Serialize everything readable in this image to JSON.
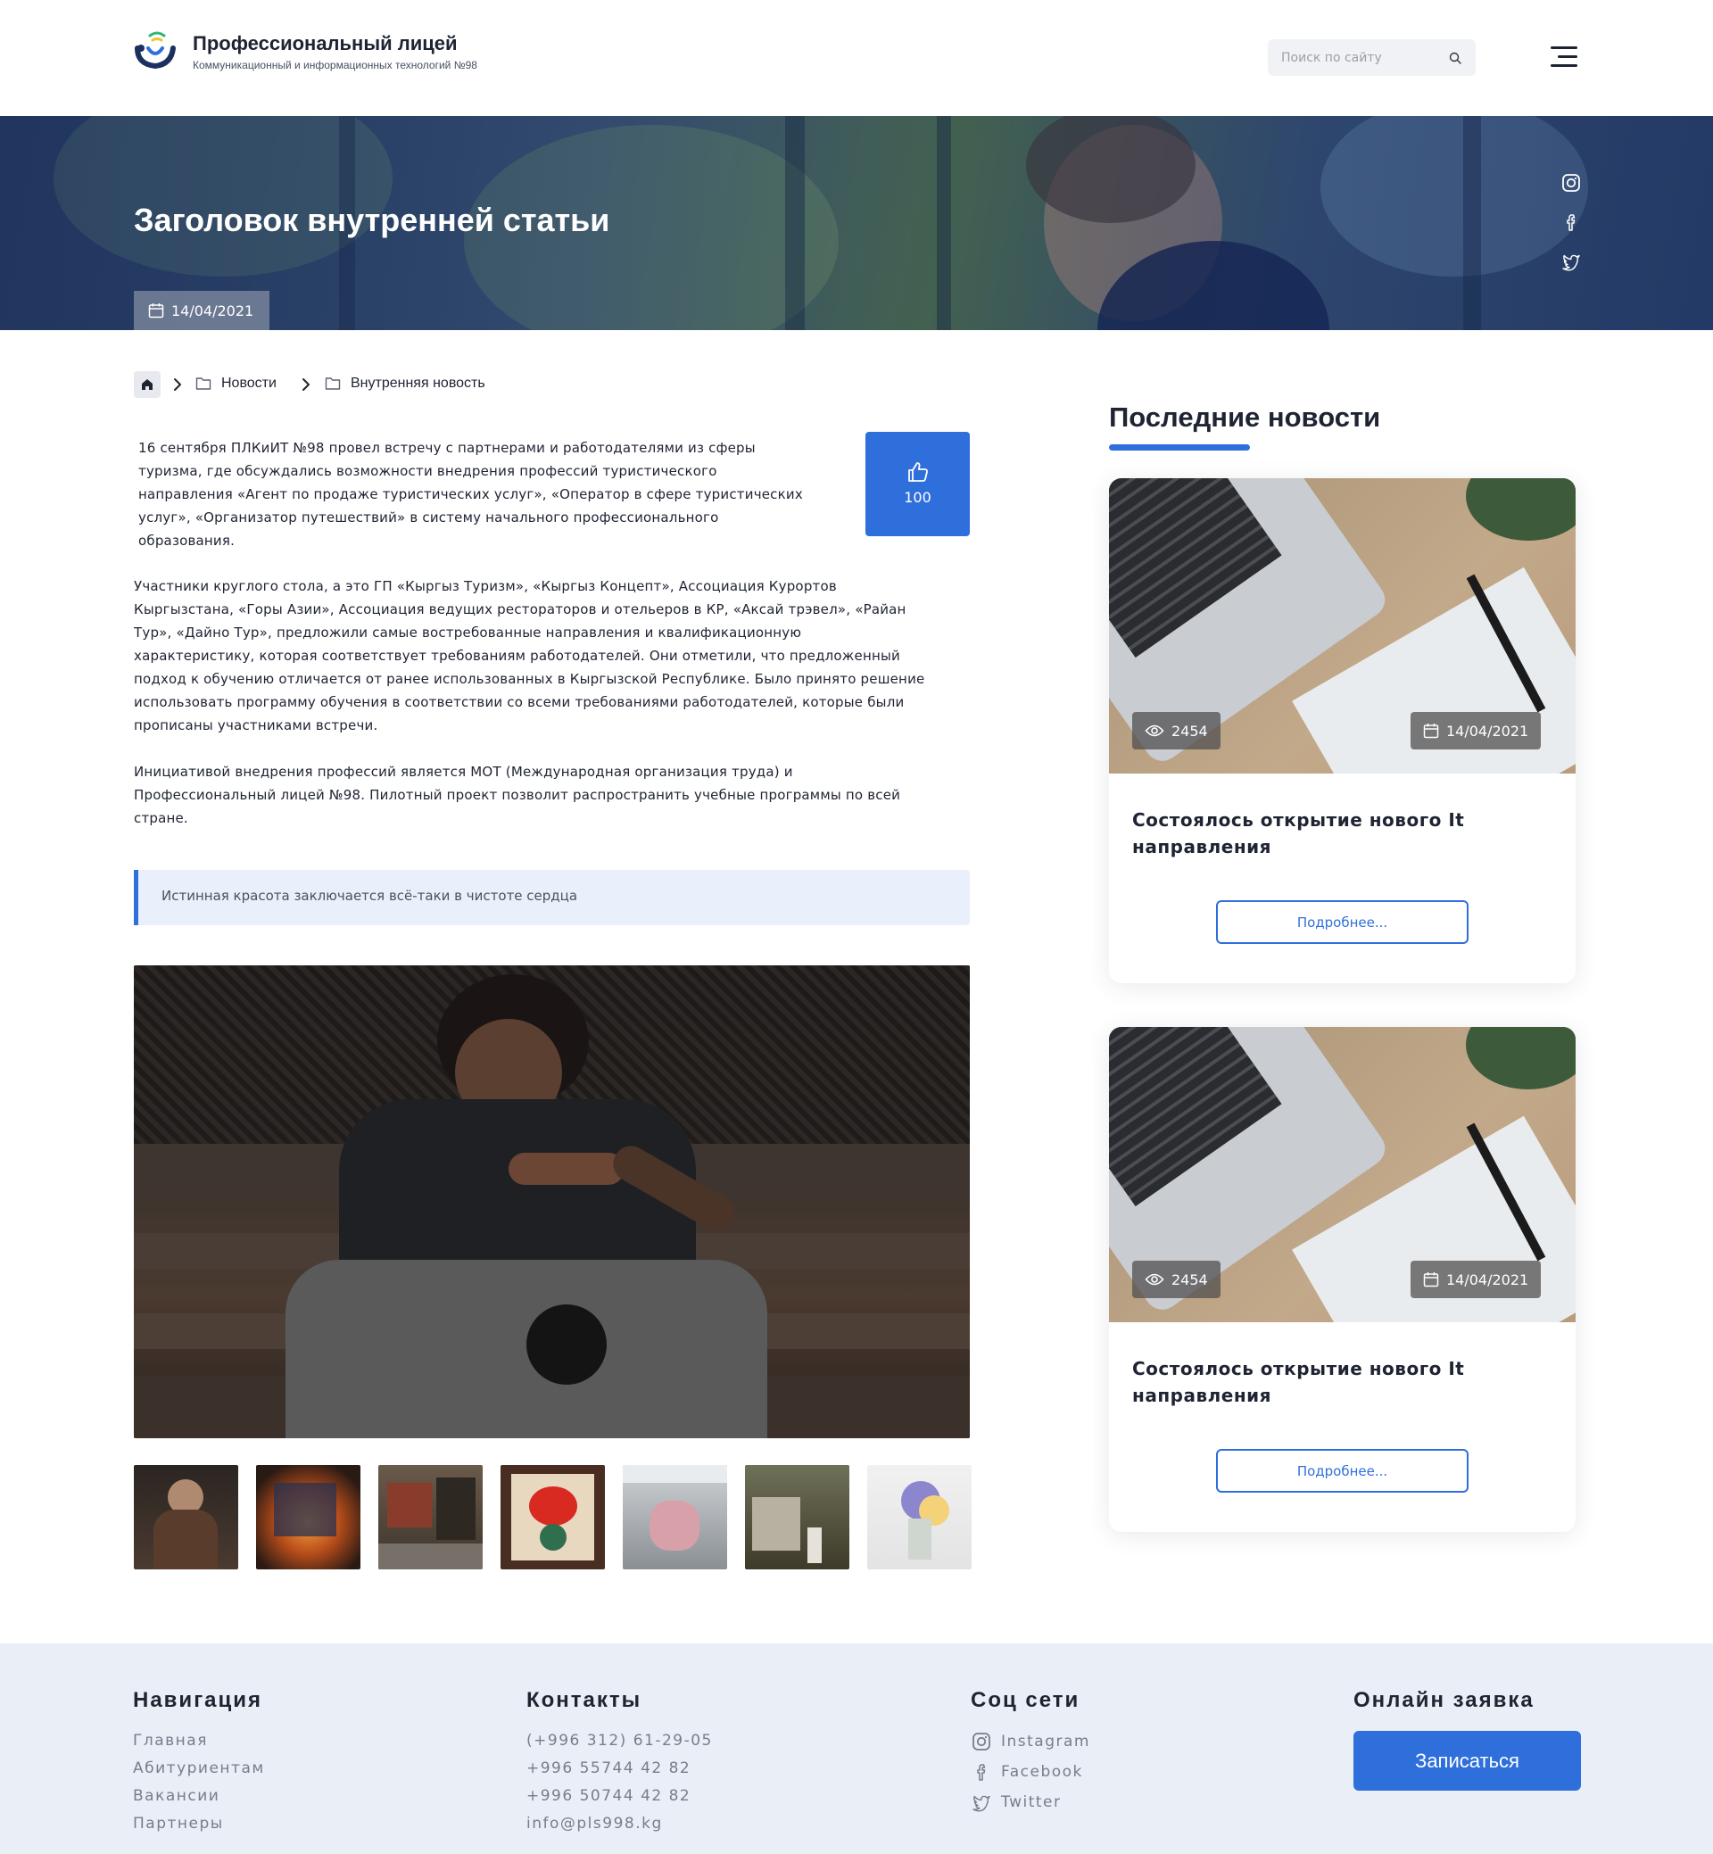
{
  "header": {
    "brand_title": "Профессиональный лицей",
    "brand_subtitle": "Коммуникационный и информационных технологий №98",
    "search_placeholder": "Поиск по сайту"
  },
  "hero": {
    "title": "Заголовок внутренней статьи",
    "date": "14/04/2021",
    "social_icons": [
      "instagram-icon",
      "facebook-icon",
      "twitter-icon"
    ]
  },
  "breadcrumb": {
    "items": [
      "Новости",
      "Внутренняя новость"
    ]
  },
  "article": {
    "paragraph1_lines": [
      "16 сентября ПЛКиИТ №98 провел встречу с партнерами и работодателями из сферы",
      "туризма, где обсуждались возможности внедрения профессий туристического",
      "направления «Агент по продаже туристических услуг», «Оператор в сфере туристических",
      "услуг», «Организатор путешествий» в систему начального профессионального",
      "образования."
    ],
    "paragraph2_lines": [
      "Участники круглого стола, а это ГП «Кыргыз Туризм», «Кыргыз Концепт», Ассоциация Курортов",
      "Кыргызстана, «Горы Азии», Ассоциация ведущих рестораторов и отельеров в КР, «Аксай трэвел», «Райан",
      "Тур», «Дайно Тур», предложили самые востребованные направления и квалификационную",
      "характеристику, которая соответствует требованиям работодателей. Они отметили, что предложенный",
      "подход к обучению отличается от ранее использованных в Кыргызской Республике. Было принято решение",
      "использовать программу обучения в соответствии со всеми требованиями работодателей, которые были",
      "прописаны участниками встречи."
    ],
    "paragraph3_lines": [
      "Инициативой внедрения профессий является МОТ (Международная организация труда) и",
      "Профессиональный лицей №98. Пилотный проект позволит распространить учебные программы по всей",
      "стране."
    ],
    "likes": "100",
    "quote": "Истинная красота заключается всё-таки в чистоте сердца"
  },
  "sidebar": {
    "title": "Последние новости",
    "cards": [
      {
        "views": "2454",
        "date": "14/04/2021",
        "title": "Состоялось открытие нового It направления",
        "button": "Подробнее..."
      },
      {
        "views": "2454",
        "date": "14/04/2021",
        "title": "Состоялось открытие нового It направления",
        "button": "Подробнее..."
      }
    ]
  },
  "footer": {
    "nav_title": "Навигация",
    "nav_links": [
      "Главная",
      "Абитуриентам",
      "Вакансии",
      "Партнеры"
    ],
    "contacts_title": "Контакты",
    "contacts": [
      "(+996 312) 61-29-05",
      "+996 55744 42 82",
      "+996 50744 42 82",
      "info@pls998.kg"
    ],
    "social_title": "Соц сети",
    "social_links": [
      "Instagram",
      "Facebook",
      "Twitter"
    ],
    "apply_title": "Онлайн заявка",
    "apply_button": "Записаться"
  },
  "colors": {
    "accent": "#2f6fdc",
    "quote_bg": "#eaf0fb",
    "footer_bg": "#eaeef6"
  }
}
